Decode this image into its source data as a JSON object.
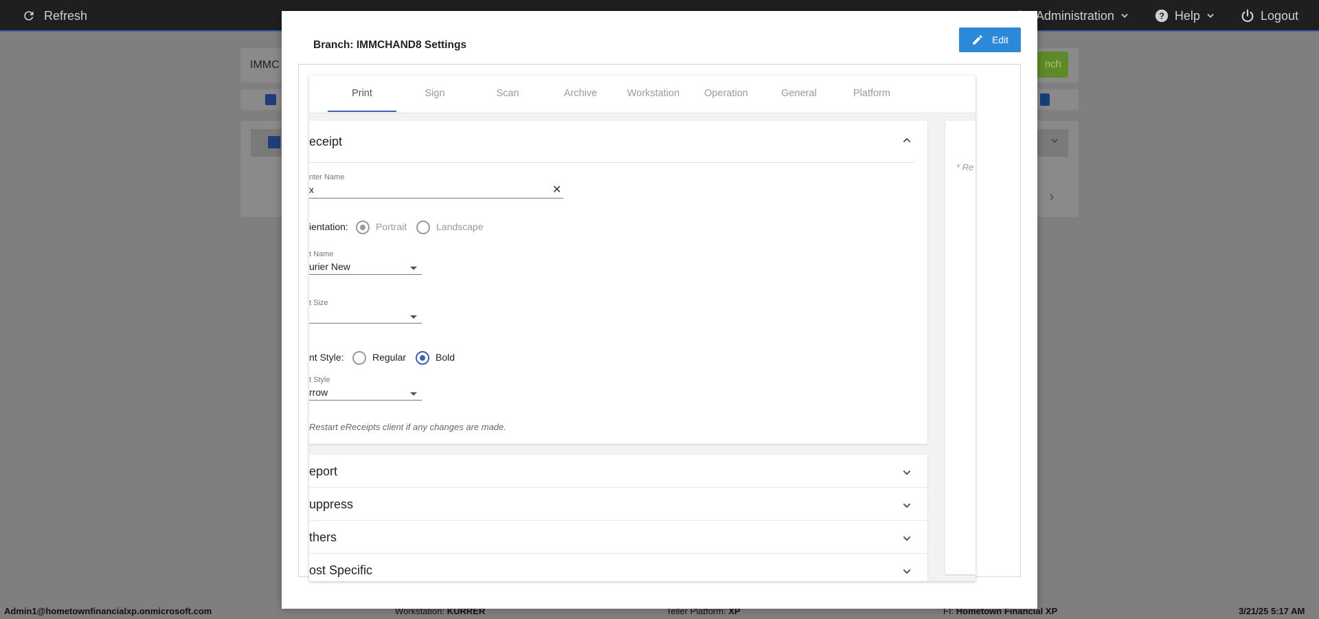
{
  "topbar": {
    "refresh_label": "Refresh",
    "nav": [
      {
        "label": "Administration",
        "icon": "admin-icon"
      },
      {
        "label": "Help",
        "icon": "help-icon"
      },
      {
        "label": "Logout",
        "icon": "power-icon"
      }
    ]
  },
  "background": {
    "search_value": "IMMC",
    "search_button": "nch"
  },
  "modal": {
    "title": "Branch: IMMCHAND8 Settings",
    "edit_label": "Edit",
    "tabs": [
      "Print",
      "Sign",
      "Scan",
      "Archive",
      "Workstation",
      "Operation",
      "General",
      "Platform"
    ],
    "active_tab": "Print",
    "receipt": {
      "title": "eceipt",
      "printer_name_label": "nter Name",
      "printer_name_value": "x",
      "clear_symbol": "✕",
      "orientation_label": "ientation:",
      "orientation_options": [
        "Portrait",
        "Landscape"
      ],
      "orientation_selected": "Portrait",
      "font_name_label": "t Name",
      "font_name_value": "urier New",
      "font_size_label": "t Size",
      "font_size_value": "",
      "font_style_label": "nt Style:",
      "font_style_options": [
        "Regular",
        "Bold"
      ],
      "font_style_selected": "Bold",
      "text_style_label": "t Style",
      "text_style_value": "rrow",
      "note": "Restart eReceipts client if any changes are made."
    },
    "accordion": [
      "eport",
      "uppress",
      "thers",
      "ost Specific"
    ],
    "side_note": "* Re"
  },
  "statusbar": {
    "user": "Admin1@hometownfinancialxp.onmicrosoft.com",
    "workstation_label": "Workstation:",
    "workstation_value": "KURRER",
    "platform_label": "Teller Platform:",
    "platform_value": "XP",
    "fi_label": "FI:",
    "fi_value": "Hometown Financial XP",
    "datetime": "3/21/25 5:17 AM"
  },
  "colors": {
    "accent": "#2e88d8",
    "tab_underline": "#3a5fb5",
    "topbar": "#1f1f1f",
    "overlay": "#7f7f7f"
  }
}
